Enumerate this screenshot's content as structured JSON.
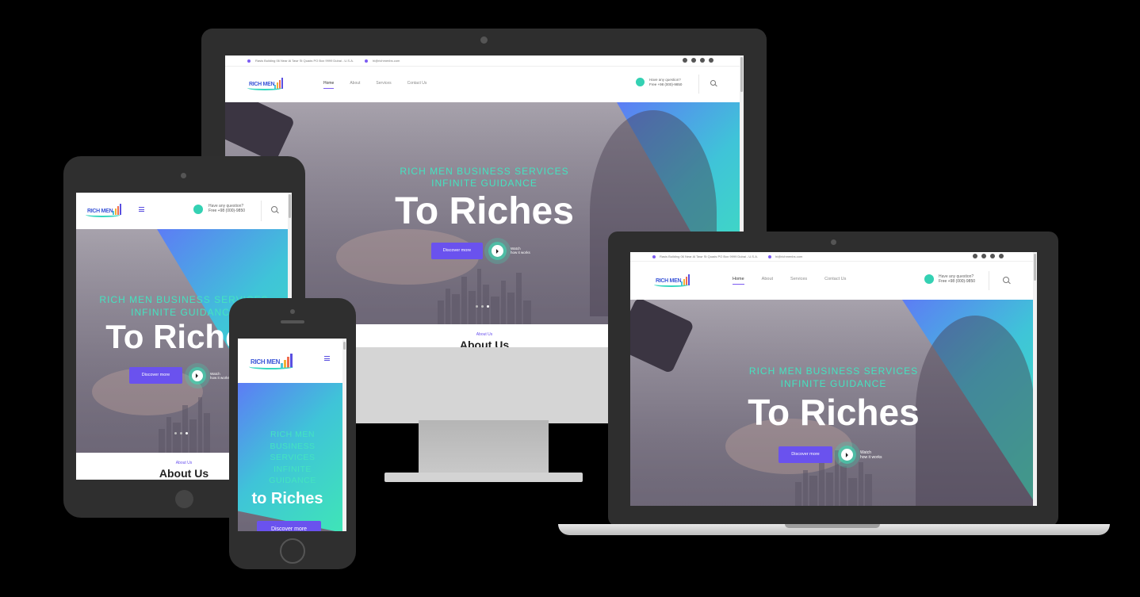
{
  "site": {
    "topbar": {
      "address": "Rasis Building 06 Near Al Tawr St Quads PO Box 9999 Dubai - U.S.A.",
      "email": "hi@richmenbs.com"
    },
    "logo": {
      "text": "RICH MEN"
    },
    "nav": {
      "home": "Home",
      "about": "About",
      "services": "Services",
      "contact": "Contact Us"
    },
    "contact": {
      "question": "Have any question?",
      "phone": "Free +98 (000)-9850"
    },
    "hero": {
      "subtitle_line1": "RICH MEN BUSINESS SERVICES",
      "subtitle_line2": "INFINITE GUIDANCE",
      "title": "To Riches",
      "title_mobile": "to Riches",
      "button": "Discover more",
      "watch_line1": "Watch",
      "watch_line2": "how it works"
    },
    "about": {
      "tag": "About Us",
      "heading": "About Us"
    },
    "mobile_subtitle": [
      "RICH MEN",
      "BUSINESS",
      "SERVICES",
      "INFINITE",
      "GUIDANCE"
    ]
  },
  "colors": {
    "accent": "#6a52ee",
    "teal": "#44e3c0",
    "logo_blue": "#3b56d8"
  },
  "icons": [
    "facebook-icon",
    "instagram-icon",
    "linkedin-icon",
    "tiktok-icon",
    "chat-icon",
    "search-icon",
    "hamburger-icon",
    "play-icon",
    "location-icon",
    "email-icon"
  ]
}
